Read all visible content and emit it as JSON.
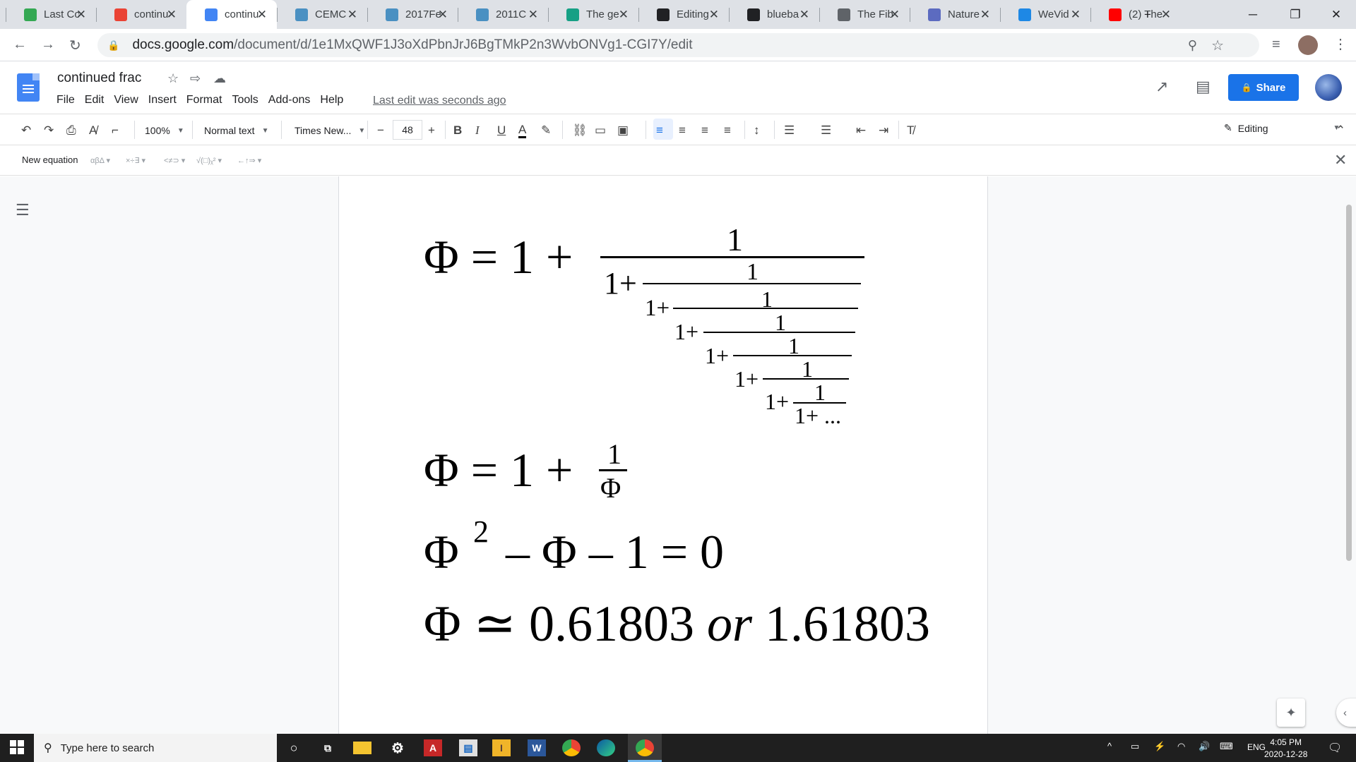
{
  "browser": {
    "tabs": [
      {
        "title": "Last Co",
        "icon": "google-drive-icon",
        "color": "#34a853"
      },
      {
        "title": "continu",
        "icon": "red-app-icon",
        "color": "#ea4335"
      },
      {
        "title": "continu",
        "icon": "google-docs-icon",
        "color": "#4285f4",
        "active": true
      },
      {
        "title": "CEMC",
        "icon": "cemc-icon",
        "color": "#4a90c2"
      },
      {
        "title": "2017Fe",
        "icon": "cemc-icon",
        "color": "#4a90c2"
      },
      {
        "title": "2011C",
        "icon": "cemc-icon",
        "color": "#4a90c2"
      },
      {
        "title": "The ge",
        "icon": "shield-icon",
        "color": "#16a085"
      },
      {
        "title": "Editing",
        "icon": "github-icon",
        "color": "#202124"
      },
      {
        "title": "blueba",
        "icon": "github-icon",
        "color": "#202124"
      },
      {
        "title": "The Fib",
        "icon": "globe-icon",
        "color": "#5f6368"
      },
      {
        "title": "Nature",
        "icon": "nature-icon",
        "color": "#5c6bc0"
      },
      {
        "title": "WeVid",
        "icon": "wevideo-icon",
        "color": "#1e88e5"
      },
      {
        "title": "(2) The",
        "icon": "youtube-icon",
        "color": "#ff0000"
      }
    ],
    "new_tab": "+",
    "url_host": "docs.google.com",
    "url_path": "/document/d/1e1MxQWF1J3oXdPbnJrJ6BgTMkP2n3WvbONVg1-CGI7Y/edit"
  },
  "docs": {
    "title": "continued frac",
    "menu": [
      "File",
      "Edit",
      "View",
      "Insert",
      "Format",
      "Tools",
      "Add-ons",
      "Help"
    ],
    "last_edit": "Last edit was seconds ago",
    "share_label": "Share",
    "toolbar": {
      "zoom": "100%",
      "style": "Normal text",
      "font": "Times New...",
      "font_size": "48",
      "mode": "Editing"
    },
    "equation_bar": {
      "new_equation": "New equation",
      "groups": [
        "αβΔ ▾",
        "×÷∃ ▾",
        "<≠⊃ ▾",
        "√(□)ᵪ² ▾",
        "←↑⇒ ▾"
      ]
    }
  },
  "document": {
    "eq1": {
      "lhs": "Φ = 1 +",
      "one": "1",
      "nest": "1+",
      "tail": "1+ ..."
    },
    "eq2": {
      "lhs": "Φ = 1 +",
      "num": "1",
      "den": "Φ"
    },
    "eq3": {
      "base": "Φ",
      "exp": "2",
      "rest": "– Φ – 1 = 0"
    },
    "eq4": {
      "lhs": "Φ ≃ 0.61803",
      "or": "or",
      "rhs": "1.61803"
    }
  },
  "taskbar": {
    "search_placeholder": "Type here to search",
    "lang": "ENG",
    "time": "4:05 PM",
    "date": "2020-12-28"
  }
}
